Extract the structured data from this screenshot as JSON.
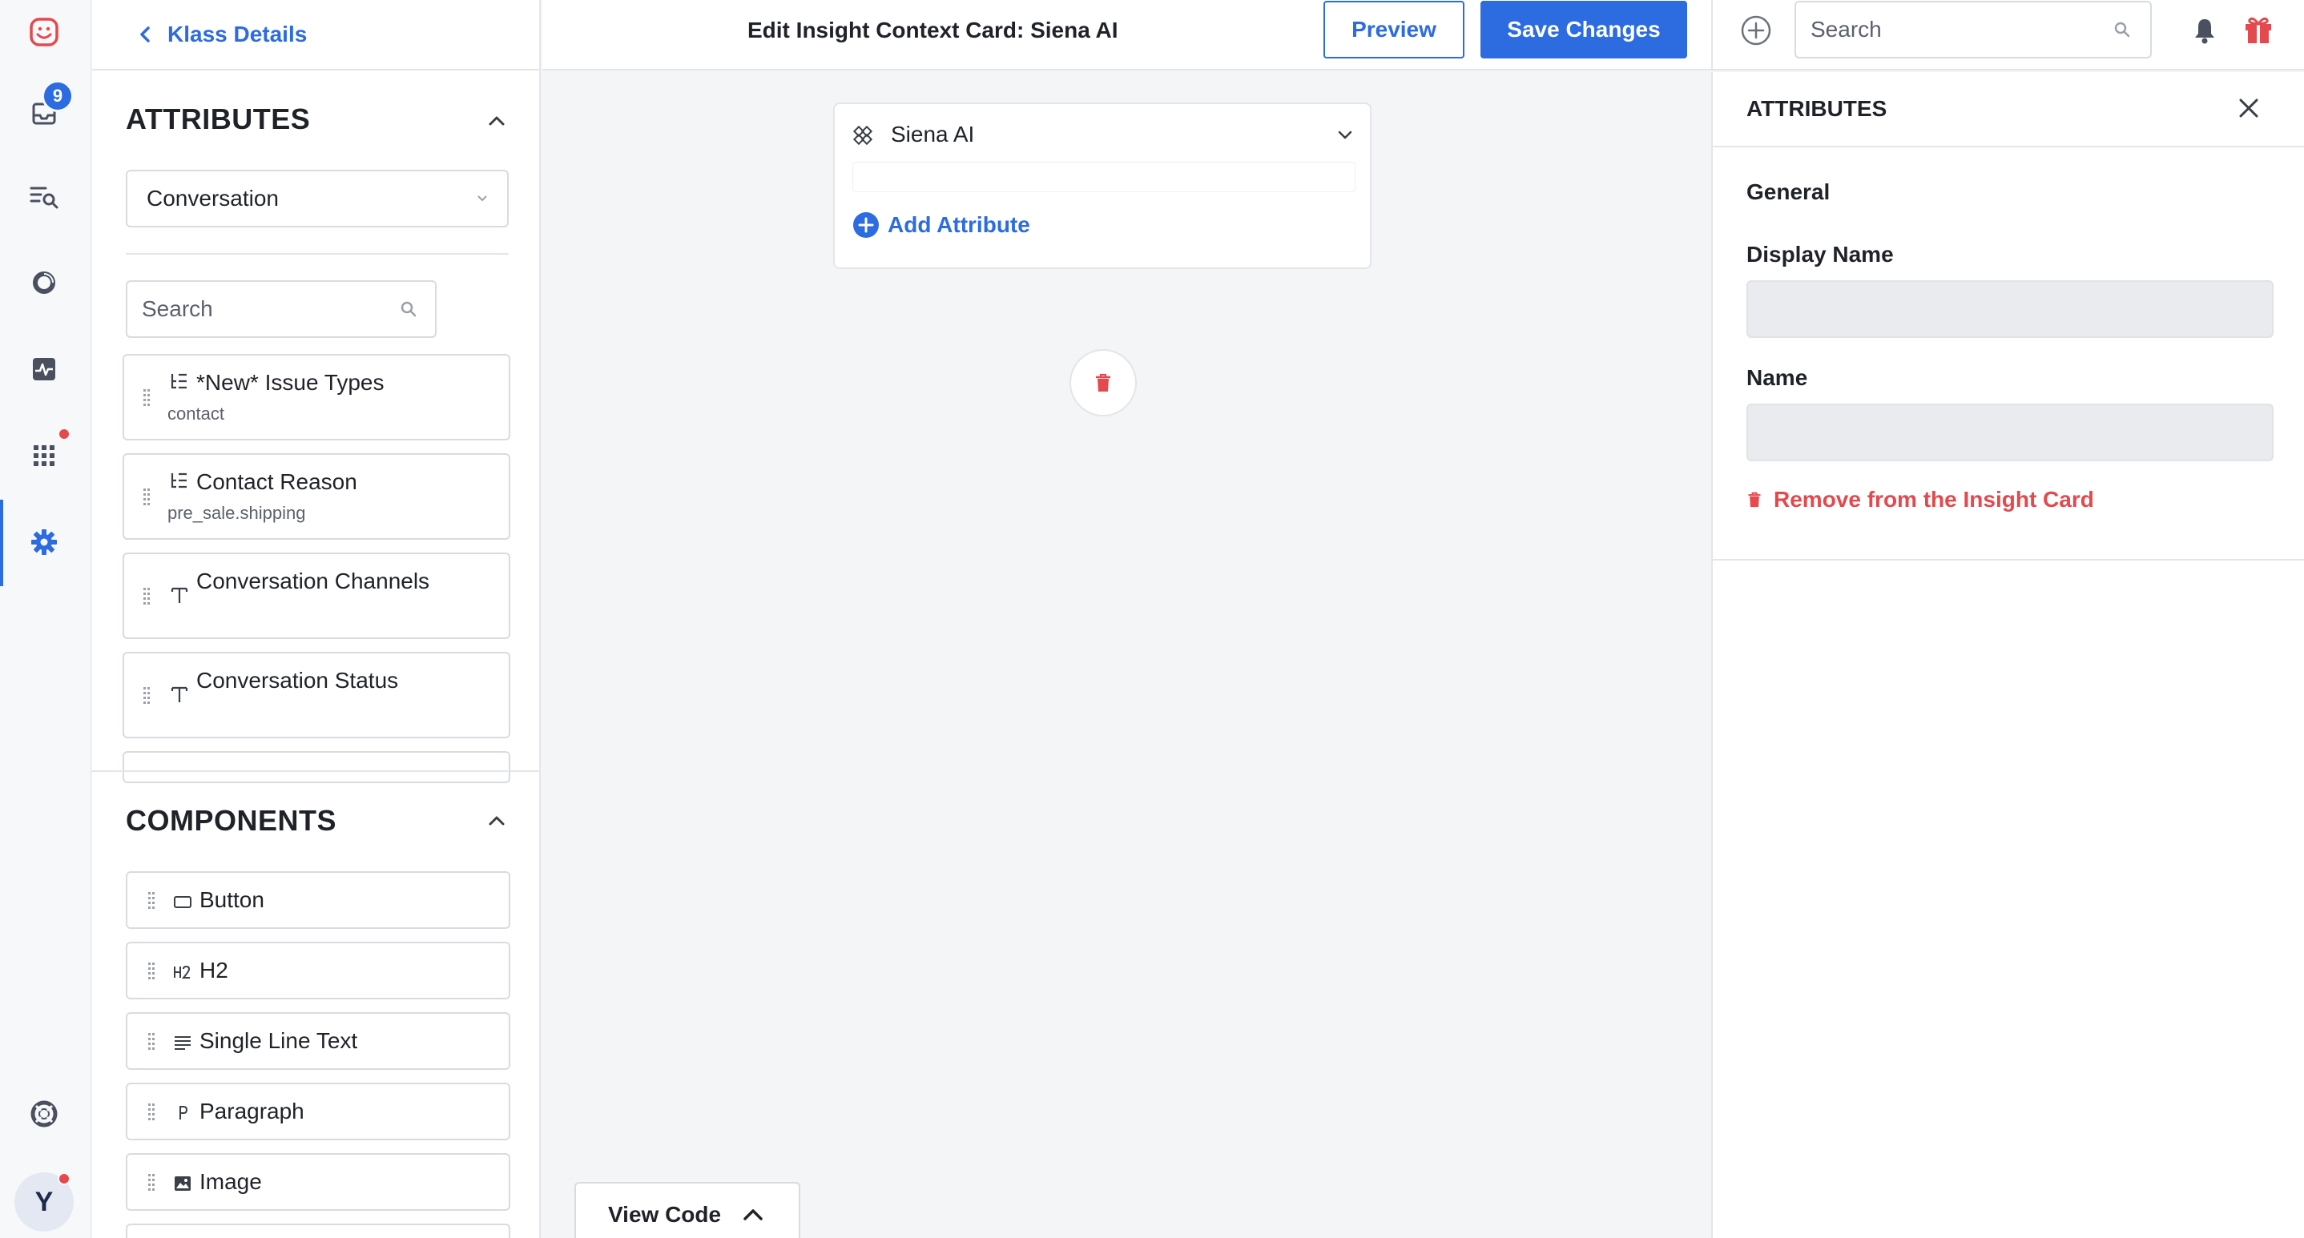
{
  "nav": {
    "inbox_badge": "9",
    "avatar_initial": "Y"
  },
  "left_panel": {
    "back_label": "Klass Details",
    "attributes_title": "ATTRIBUTES",
    "selected_object": "Conversation",
    "search_placeholder": "Search",
    "attributes": [
      {
        "title": "*New* Issue Types",
        "subtitle": "contact",
        "icon": "tree-icon"
      },
      {
        "title": "Contact Reason",
        "subtitle": "pre_sale.shipping",
        "icon": "tree-icon"
      },
      {
        "title": "Conversation Channels",
        "subtitle": "",
        "icon": "text-type-icon"
      },
      {
        "title": "Conversation Status",
        "subtitle": "",
        "icon": "text-type-icon"
      }
    ],
    "components_title": "COMPONENTS",
    "components": [
      {
        "label": "Button",
        "icon": "button-icon"
      },
      {
        "label": "H2",
        "icon": "h2-icon"
      },
      {
        "label": "Single Line Text",
        "icon": "lines-icon"
      },
      {
        "label": "Paragraph",
        "icon": "paragraph-icon"
      },
      {
        "label": "Image",
        "icon": "image-icon"
      }
    ]
  },
  "header": {
    "title": "Edit Insight Context Card: Siena AI",
    "preview_label": "Preview",
    "save_label": "Save Changes"
  },
  "canvas": {
    "card_title": "Siena AI",
    "add_attribute_label": "Add Attribute",
    "view_code_label": "View Code"
  },
  "right_top": {
    "search_placeholder": "Search"
  },
  "right_panel": {
    "title": "ATTRIBUTES",
    "general_label": "General",
    "display_name_label": "Display Name",
    "display_name_value": "",
    "name_label": "Name",
    "name_value": "",
    "remove_label": "Remove from the Insight Card"
  },
  "colors": {
    "accent": "#2c6be0",
    "danger": "#e5484d",
    "brand": "#e5484d"
  }
}
